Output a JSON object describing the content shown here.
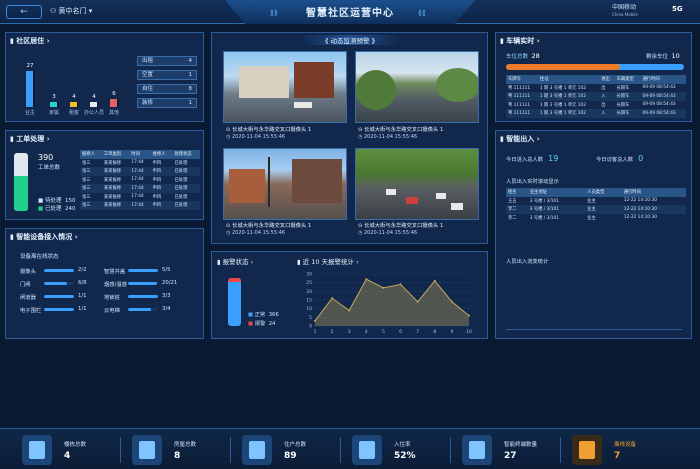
{
  "header": {
    "back_icon": "arrow-left-icon",
    "location": "黄中名门",
    "title": "智慧社区运营中心",
    "brand_name": "中国移动",
    "brand_sub": "China Mobile",
    "badge": "5G"
  },
  "community": {
    "title": "社区居住",
    "bars": [
      {
        "value": "27",
        "label": "业主",
        "color": "#3aa0ff"
      },
      {
        "value": "3",
        "label": "家属",
        "color": "#29d3c8"
      },
      {
        "value": "4",
        "label": "租客",
        "color": "#f0c020"
      },
      {
        "value": "4",
        "label": "办公人员",
        "color": "#e8e8f0"
      },
      {
        "value": "6",
        "label": "其他",
        "color": "#e66060"
      }
    ],
    "rows": [
      {
        "label": "出租",
        "value": "4"
      },
      {
        "label": "空置",
        "value": "1"
      },
      {
        "label": "自住",
        "value": "8"
      },
      {
        "label": "装修",
        "value": "1"
      }
    ]
  },
  "workorder": {
    "title": "工单处理",
    "total_value": "390",
    "total_label": "工单总数",
    "pending_label": "待处理",
    "pending_value": "150",
    "done_label": "已处理",
    "done_value": "240",
    "table_headers": [
      "报修人",
      "工单类别",
      "时间",
      "维修人",
      "处理状态"
    ],
    "table_rows": [
      [
        "张三",
        "某某报修",
        "17:44",
        "申四",
        "已处理"
      ],
      [
        "张三",
        "某某报修",
        "17:44",
        "申四",
        "已处理"
      ],
      [
        "张三",
        "某某报修",
        "17:44",
        "申四",
        "已处理"
      ],
      [
        "张三",
        "某某报修",
        "17:44",
        "申四",
        "已处理"
      ],
      [
        "张三",
        "某某报修",
        "17:44",
        "申四",
        "已处理"
      ],
      [
        "张三",
        "某某报修",
        "17:44",
        "申四",
        "已处理"
      ]
    ]
  },
  "devices": {
    "title": "智能设备接入情况",
    "subtitle": "设备离在线状态",
    "left": [
      {
        "name": "摄像头",
        "value": "2/2",
        "fill": 1.0
      },
      {
        "name": "门闸",
        "value": "6/8",
        "fill": 0.75
      },
      {
        "name": "闸道器",
        "value": "1/1",
        "fill": 1.0
      },
      {
        "name": "电子围栏",
        "value": "1/1",
        "fill": 1.0
      }
    ],
    "right": [
      {
        "name": "智慧井盖",
        "value": "5/5",
        "fill": 1.0
      },
      {
        "name": "烟感/温感",
        "value": "20/21",
        "fill": 0.95
      },
      {
        "name": "地锁桩",
        "value": "3/3",
        "fill": 1.0
      },
      {
        "name": "云电梯",
        "value": "3/4",
        "fill": 0.75
      }
    ]
  },
  "monitor": {
    "title": "动态监测预警",
    "cameras": [
      {
        "name": "长城大街与永华路交叉口摄像头 1",
        "time": "2020-11-04 15:55:46"
      },
      {
        "name": "长城大街与永华路交叉口摄像头 1",
        "time": "2020-11-04 15:55:46"
      },
      {
        "name": "长城大街与永华路交叉口摄像头 1",
        "time": "2020-11-04 15:55:46"
      },
      {
        "name": "长城大街与永华路交叉口摄像头 1",
        "time": "2020-11-04 15:55:46"
      }
    ]
  },
  "alarm_status": {
    "title": "报警状态",
    "normal_label": "正常",
    "normal_value": "366",
    "alarm_label": "报警",
    "alarm_value": "24",
    "colors": {
      "normal": "#3aa0ff",
      "alarm": "#e84a4a"
    }
  },
  "alarm_stats": {
    "title": "近 10 天报警统计"
  },
  "chart_data": {
    "type": "area",
    "x": [
      1,
      2,
      3,
      4,
      5,
      6,
      7,
      8,
      9,
      10
    ],
    "values": [
      3,
      16,
      9,
      27,
      22,
      24,
      14,
      26,
      14,
      6
    ],
    "ylim": [
      0,
      30
    ],
    "yticks": [
      0,
      5,
      10,
      15,
      20,
      25,
      30
    ],
    "grid": true,
    "color": "#c8a85a"
  },
  "vehicle": {
    "title": "车辆实时",
    "total_label": "车位总数",
    "total_value": "28",
    "remain_label": "剩余车位",
    "remain_value": "10",
    "occupied_fraction": 0.64,
    "headers": [
      "车牌号",
      "住址",
      "进出",
      "车辆类型",
      "通行时间"
    ],
    "rows": [
      [
        "粤 111111",
        "1 期 3 号楼 1 单元 102",
        "出",
        "长期车",
        "09-09 08:54:43"
      ],
      [
        "粤 111111",
        "1 期 3 号楼 1 单元 102",
        "入",
        "长期车",
        "09-09 08:54:43"
      ],
      [
        "粤 111111",
        "1 期 3 号楼 1 单元 102",
        "出",
        "长期车",
        "09-09 08:54:43"
      ],
      [
        "粤 111111",
        "1 期 3 号楼 1 单元 102",
        "入",
        "长期车",
        "09-09 08:54:43"
      ]
    ]
  },
  "access": {
    "title": "智能出入",
    "today_in_label": "今日进入总人数",
    "today_in_value": "19",
    "today_out_label": "今日访客总人数",
    "today_out_value": "0",
    "realtime_label": "人员出入实时滚动显示",
    "headers": [
      "姓名",
      "业主地址",
      "人员类型",
      "通行时间"
    ],
    "rows": [
      [
        "王五",
        "3 号楼 / 3/101",
        "业主",
        "12-22 14:10:30"
      ],
      [
        "李二",
        "3 号楼 / 3/101",
        "业主",
        "12-22 14:10:30"
      ],
      [
        "李二",
        "3 号楼 / 3/101",
        "业主",
        "12-22 14:10:30"
      ]
    ],
    "trend_label": "人员出入流变统计"
  },
  "footer": [
    {
      "label": "楼栋总数",
      "value": "4",
      "icon": "building-icon",
      "highlight": false
    },
    {
      "label": "房屋总数",
      "value": "8",
      "icon": "house-icon",
      "highlight": false
    },
    {
      "label": "住户总数",
      "value": "89",
      "icon": "residents-icon",
      "highlight": false
    },
    {
      "label": "入住率",
      "value": "52%",
      "icon": "occupancy-chart-icon",
      "highlight": false
    },
    {
      "label": "智能终端数量",
      "value": "27",
      "icon": "terminal-icon",
      "highlight": false
    },
    {
      "label": "离线设备",
      "value": "7",
      "icon": "warning-icon",
      "highlight": true
    }
  ]
}
